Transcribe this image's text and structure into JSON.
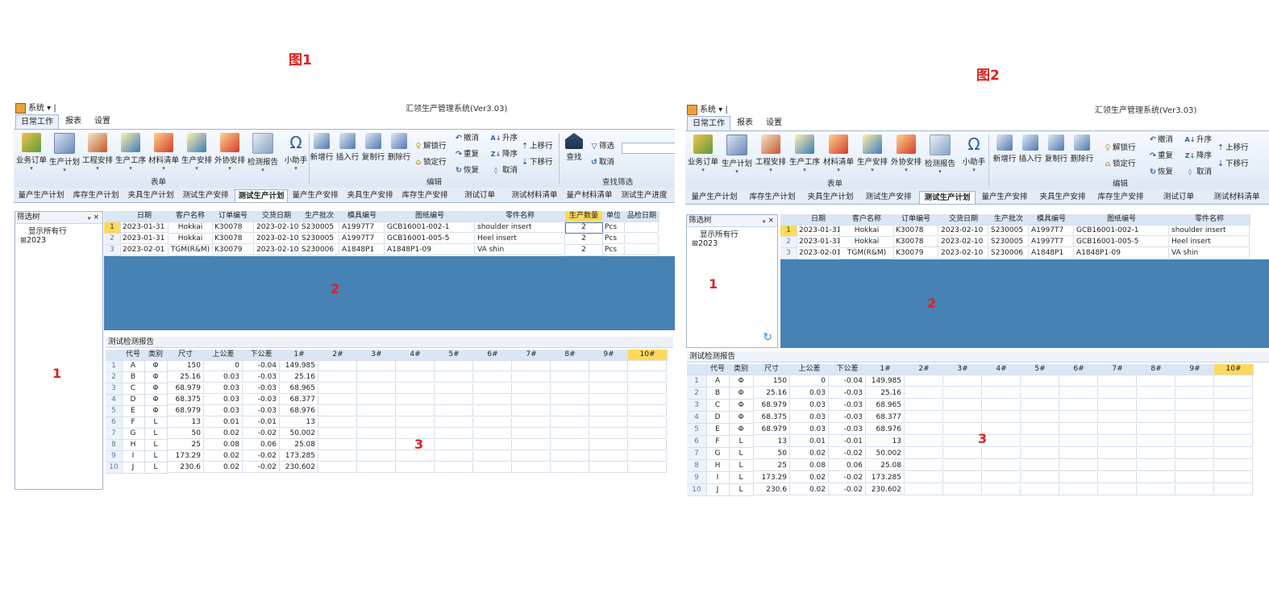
{
  "figure_labels": {
    "fig1": "图1",
    "fig2": "图2"
  },
  "annotations": {
    "a1": "1",
    "a2": "2",
    "a3": "3"
  },
  "app": {
    "system_menu": "系统",
    "title": "汇领生产管理系统(Ver3.03)",
    "menu_tabs": [
      "日常工作",
      "报表",
      "设置"
    ],
    "ribbon_buttons": [
      "业务订单",
      "生产计划",
      "工程安排",
      "生产工序",
      "材料清单",
      "生产安排",
      "外协安排",
      "检测报告",
      "小助手"
    ],
    "ribbon_group_form": "表单",
    "edit_buttons": [
      "新增行",
      "插入行",
      "复制行",
      "删除行"
    ],
    "edit_small": [
      "解锁行",
      "锁定行"
    ],
    "edit_small2": [
      "撤消",
      "重复",
      "恢复"
    ],
    "sort_buttons": [
      "升序",
      "降序",
      "取消"
    ],
    "move_buttons": [
      "上移行",
      "下移行"
    ],
    "ribbon_group_edit": "编辑",
    "search_button": "查找",
    "filter_buttons": [
      "筛选",
      "取消"
    ],
    "ribbon_group_filter": "查找筛选",
    "doc_tabs": [
      "量产生产计划",
      "库存生产计划",
      "夹具生产计划",
      "测试生产安排",
      "测试生产计划",
      "量产生产安排",
      "夹具生产安排",
      "库存生产安排",
      "测试订单",
      "测试材料清单",
      "量产材料清单",
      "测试生产进度"
    ],
    "active_doc_tab": 4,
    "tree_header": "筛选树",
    "tree_pins": "ᵩ ×",
    "tree_items": [
      "显示所有行",
      "2023"
    ],
    "top_grid": {
      "columns": [
        "日期",
        "客户名称",
        "订单编号",
        "交货日期",
        "生产批次",
        "模具编号",
        "图纸编号",
        "零件名称",
        "生产数量",
        "单位",
        "品检日期"
      ],
      "rows": [
        [
          "2023-01-31",
          "Hokkai",
          "K30078",
          "2023-02-10",
          "S230005",
          "A1997T7",
          "GCB16001-002-1",
          "shoulder insert",
          "2",
          "Pcs",
          ""
        ],
        [
          "2023-01-31",
          "Hokkai",
          "K30078",
          "2023-02-10",
          "S230005",
          "A1997T7",
          "GCB16001-005-5",
          "Heel insert",
          "2",
          "Pcs",
          ""
        ],
        [
          "2023-02-01",
          "TGM(R&M)",
          "K30079",
          "2023-02-10",
          "S230006",
          "A1848P1",
          "A1848P1-09",
          "VA shin",
          "2",
          "Pcs",
          ""
        ]
      ],
      "row_numbers": [
        "1",
        "2",
        "3"
      ]
    },
    "bottom_title": "测试检测报告",
    "bottom_grid": {
      "columns": [
        "代号",
        "类别",
        "尺寸",
        "上公差",
        "下公差",
        "1#",
        "2#",
        "3#",
        "4#",
        "5#",
        "6#",
        "7#",
        "8#",
        "9#",
        "10#"
      ],
      "rows": [
        [
          "A",
          "Φ",
          "150",
          "0",
          "-0.04",
          "149.985"
        ],
        [
          "B",
          "Φ",
          "25.16",
          "0.03",
          "-0.03",
          "25.16"
        ],
        [
          "C",
          "Φ",
          "68.979",
          "0.03",
          "-0.03",
          "68.965"
        ],
        [
          "D",
          "Φ",
          "68.375",
          "0.03",
          "-0.03",
          "68.377"
        ],
        [
          "E",
          "Φ",
          "68.979",
          "0.03",
          "-0.03",
          "68.976"
        ],
        [
          "F",
          "L",
          "13",
          "0.01",
          "-0.01",
          "13"
        ],
        [
          "G",
          "L",
          "50",
          "0.02",
          "-0.02",
          "50.002"
        ],
        [
          "H",
          "L",
          "25",
          "0.08",
          "0.06",
          "25.08"
        ],
        [
          "I",
          "L",
          "173.29",
          "0.02",
          "-0.02",
          "173.285"
        ],
        [
          "J",
          "L",
          "230.6",
          "0.02",
          "-0.02",
          "230.602"
        ]
      ],
      "row_numbers": [
        "1",
        "2",
        "3",
        "4",
        "5",
        "6",
        "7",
        "8",
        "9",
        "10"
      ]
    }
  },
  "colors": {
    "accent_blue": "#4682b4",
    "highlight": "#ffd95c",
    "annotation": "#e0201f"
  },
  "icons": {
    "refresh": "refresh-icon"
  }
}
